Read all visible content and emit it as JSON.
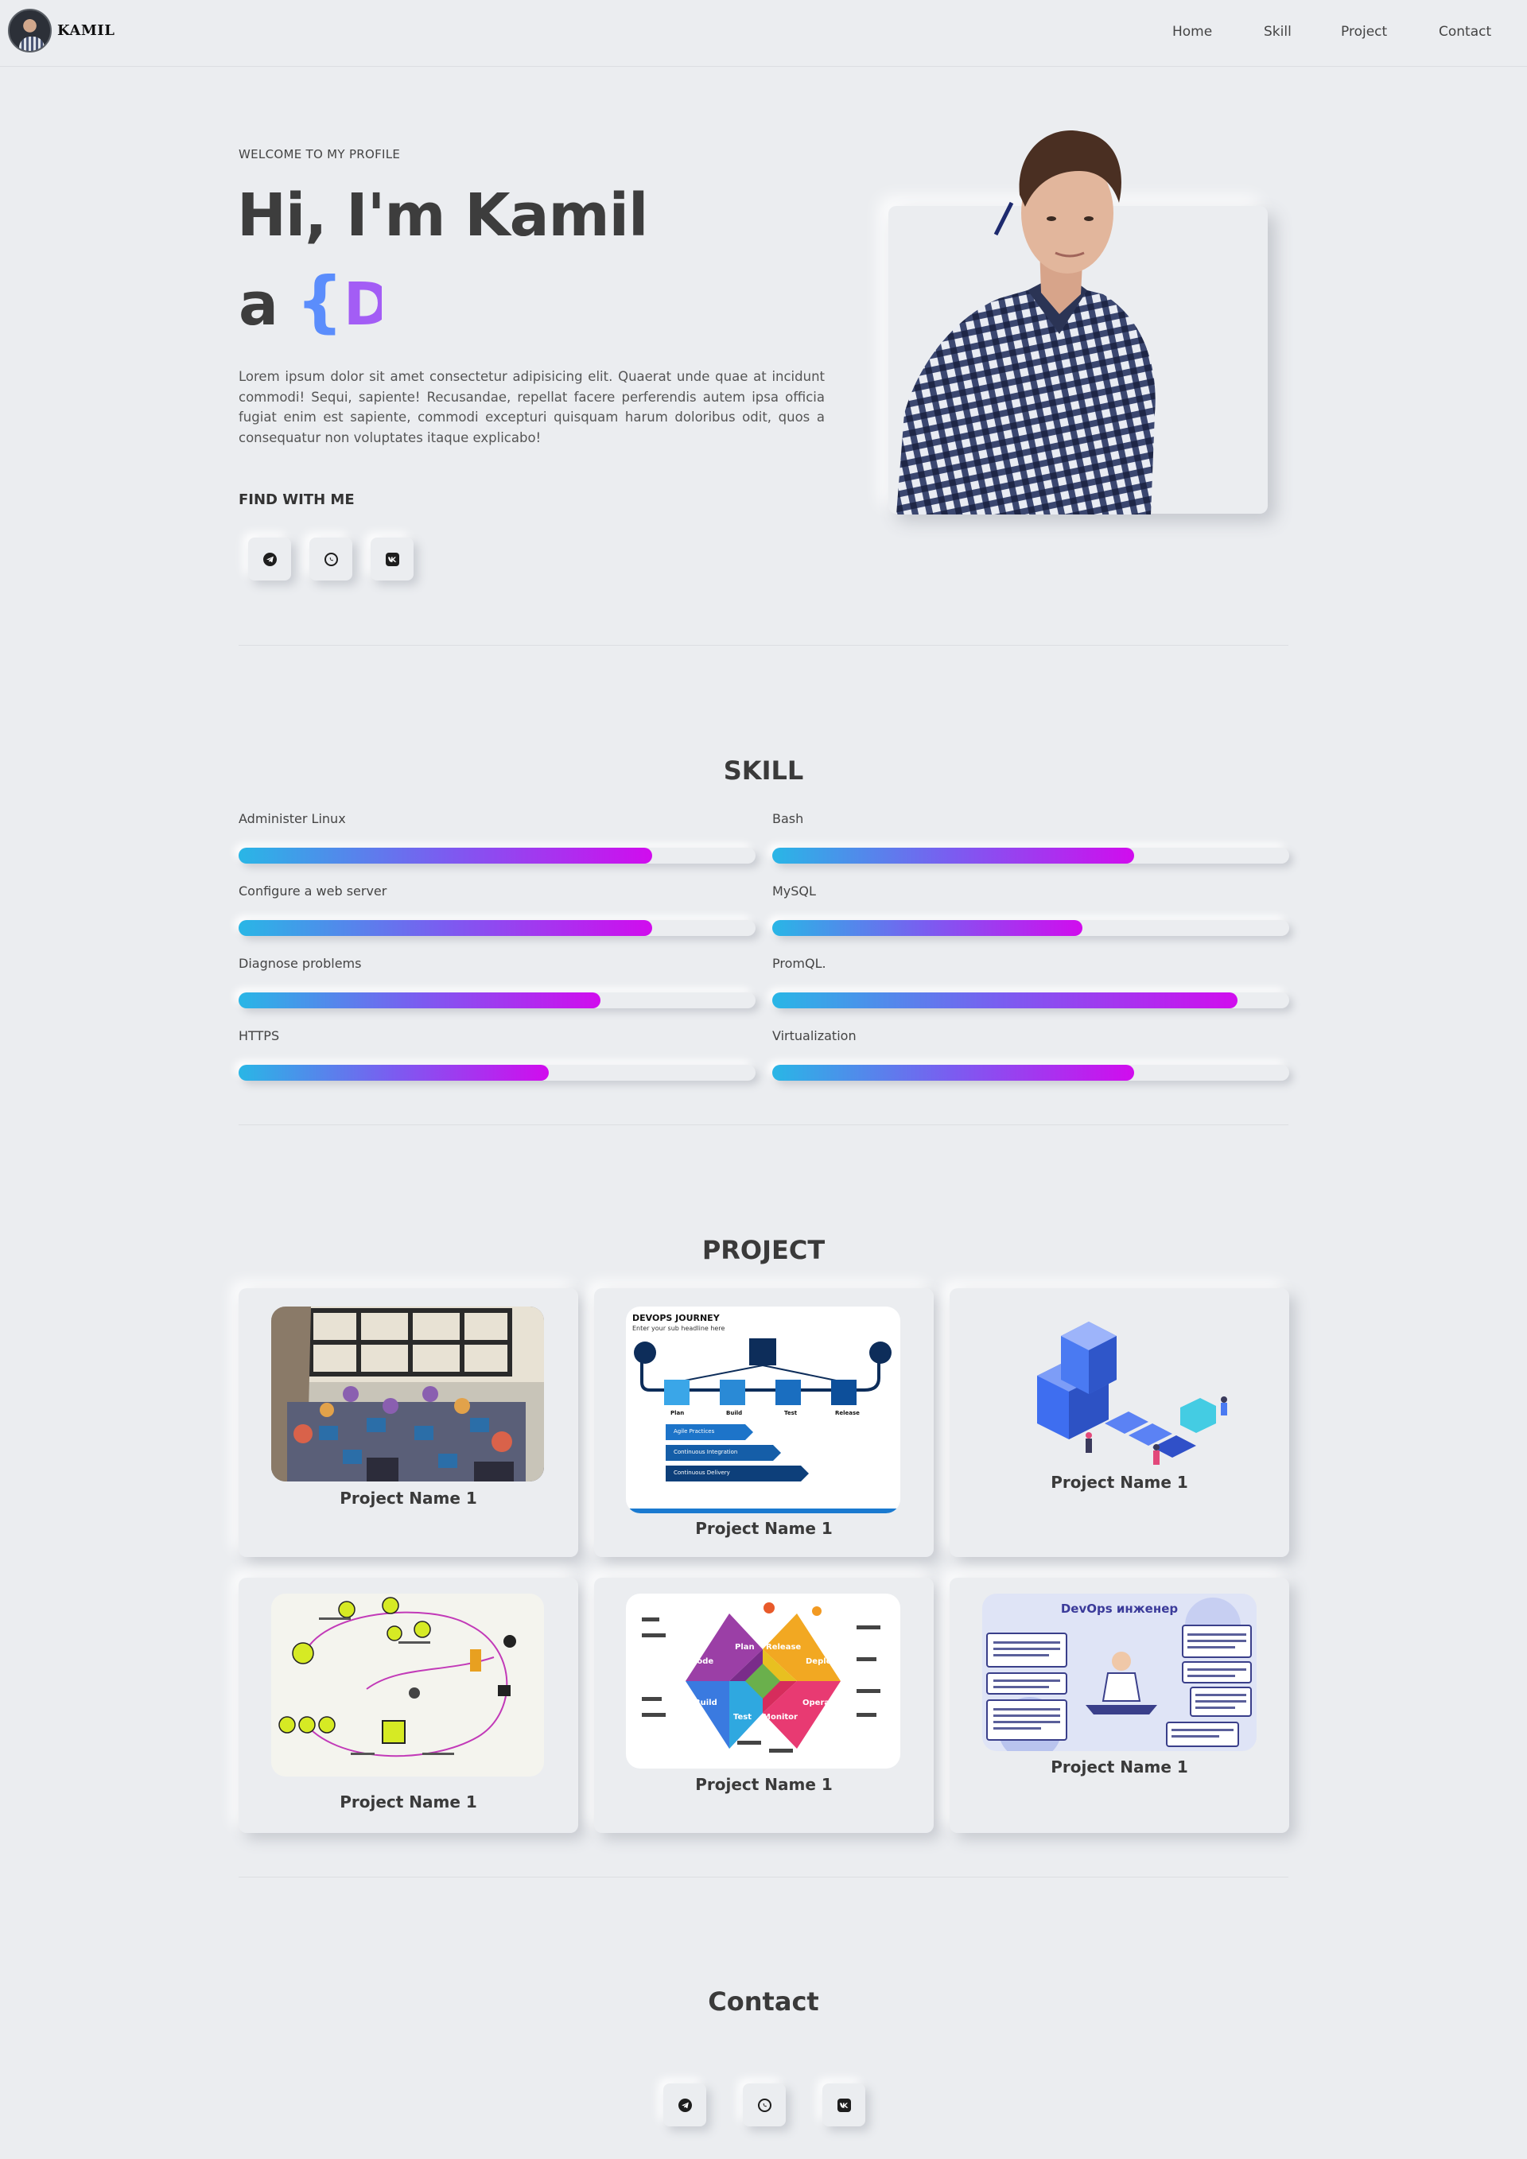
{
  "header": {
    "brand": "KAMIL",
    "nav": [
      "Home",
      "Skill",
      "Project",
      "Contact"
    ]
  },
  "hero": {
    "welcome": "WELCOME TO MY PROFILE",
    "title": "Hi, I'm Kamil",
    "role_prefix": "a",
    "role_brace": "{",
    "role_typed": "De",
    "text": "Lorem ipsum dolor sit amet consectetur adipisicing elit. Quaerat unde quae at incidunt commodi! Sequi, sapiente! Recusandae, repellat facere perferendis autem ipsa officia fugiat enim est sapiente, commodi excepturi quisquam harum doloribus odit, quos a consequatur non voluptates itaque explicabo!",
    "find_title": "FIND WITH ME"
  },
  "social_icons": [
    "telegram-icon",
    "whatsapp-icon",
    "vk-icon"
  ],
  "skills": {
    "title": "SKILL",
    "items": [
      {
        "label": "Administer Linux",
        "level": 0.8
      },
      {
        "label": "Bash",
        "level": 0.7
      },
      {
        "label": "Configure a web server",
        "level": 0.8
      },
      {
        "label": "MySQL",
        "level": 0.6
      },
      {
        "label": "Diagnose problems",
        "level": 0.7
      },
      {
        "label": "PromQL.",
        "level": 0.9
      },
      {
        "label": "HTTPS",
        "level": 0.6
      },
      {
        "label": "Virtualization",
        "level": 0.7
      }
    ]
  },
  "projects": {
    "title": "PROJECT",
    "items": [
      {
        "name": "Project Name 1"
      },
      {
        "name": "Project Name 1",
        "image_heading": "DEVOPS JOURNEY",
        "image_subheading": "Enter your sub headline here",
        "image_steps": [
          "Plan",
          "Build",
          "Test",
          "Release"
        ],
        "image_practices": [
          "Agile Practices",
          "Continuous Integration",
          "Continuous Delivery"
        ]
      },
      {
        "name": "Project Name 1"
      },
      {
        "name": "Project Name 1"
      },
      {
        "name": "Project Name 1",
        "image_labels": [
          "Code",
          "Plan",
          "Release",
          "Deploy",
          "Build",
          "Test",
          "Monitor",
          "Operate"
        ]
      },
      {
        "name": "Project Name 1",
        "image_heading": "DevOps инженер"
      }
    ]
  },
  "contact": {
    "title": "Contact"
  },
  "colors": {
    "background": "#ebedf0",
    "bar_start": "#29b6e6",
    "bar_mid": "#7b5cf0",
    "bar_end": "#d10cee",
    "brace": "#5b8dfc",
    "typed": "#a35df5"
  }
}
